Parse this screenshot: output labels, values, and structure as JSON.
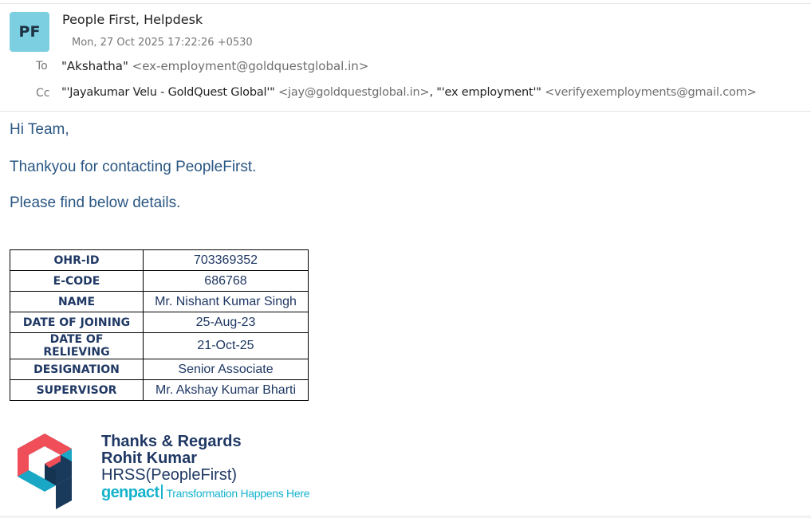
{
  "email": {
    "avatar_initials": "PF",
    "avatar_color": "#7ccfe0",
    "sender": "People First, Helpdesk",
    "date": "Mon, 27 Oct 2025 17:22:26 +0530",
    "to_label": "To",
    "to": [
      {
        "name": "\"Akshatha\"",
        "address": "<ex-employment@goldquestglobal.in>"
      }
    ],
    "cc_label": "Cc",
    "cc": [
      {
        "name": "\"'Jayakumar Velu - GoldQuest Global'\"",
        "address": "<jay@goldquestglobal.in>"
      },
      {
        "name": "\"'ex employment'\"",
        "address": "<verifyexemployments@gmail.com>"
      }
    ]
  },
  "body": {
    "greeting": "Hi Team,",
    "line1": "Thankyou for contacting PeopleFirst.",
    "line2": "Please find below details."
  },
  "details_table": [
    {
      "label": "OHR-ID",
      "value": "703369352"
    },
    {
      "label": "E-CODE",
      "value": "686768"
    },
    {
      "label": "NAME",
      "value": "Mr. Nishant Kumar Singh"
    },
    {
      "label": "DATE OF JOINING",
      "value": "25-Aug-23"
    },
    {
      "label": "DATE OF RELIEVING",
      "value": "21-Oct-25"
    },
    {
      "label": "DESIGNATION",
      "value": "Senior Associate"
    },
    {
      "label": "SUPERVISOR",
      "value": "Mr. Akshay  Kumar Bharti"
    }
  ],
  "signature": {
    "closing": "Thanks & Regards",
    "name": "Rohit Kumar",
    "team": "HRSS(PeopleFirst)",
    "logo_icon": "genpact-g-logo-icon",
    "brand_word": "genpact",
    "brand_tagline": "Transformation Happens Here",
    "brand_color": "#15b3cc",
    "text_color": "#1f3864"
  }
}
